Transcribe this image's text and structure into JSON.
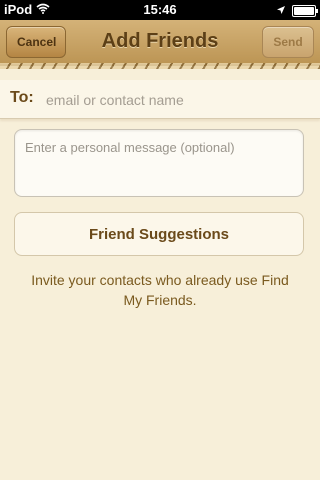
{
  "status_bar": {
    "carrier": "iPod",
    "time": "15:46",
    "wifi_icon": "wifi-icon",
    "location_icon": "location-arrow-icon",
    "battery_icon": "battery-icon"
  },
  "nav": {
    "title": "Add Friends",
    "cancel_label": "Cancel",
    "send_label": "Send"
  },
  "to_field": {
    "label": "To:",
    "placeholder": "email or contact name",
    "value": ""
  },
  "message": {
    "placeholder": "Enter a personal message (optional)",
    "value": ""
  },
  "suggestions_button": {
    "label": "Friend Suggestions"
  },
  "invite_text": "Invite your contacts who already use Find My Friends.",
  "colors": {
    "background": "#f7efd9",
    "leather": "#c8a264",
    "accent_text": "#6b4a1a"
  }
}
